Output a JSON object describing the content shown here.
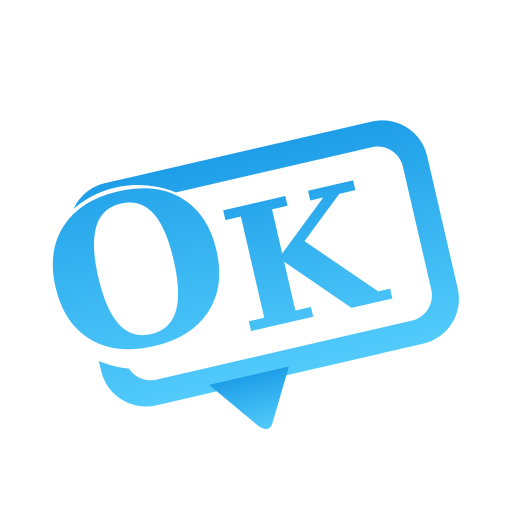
{
  "logo": {
    "text": "OK",
    "letters": [
      "O",
      "K"
    ],
    "icon": "speech-bubble-icon"
  },
  "colors": {
    "background": "#ffffff",
    "gradient_top": "#1e9ee8",
    "gradient_bottom": "#52cbfb",
    "inner_fill": "#ffffff"
  }
}
